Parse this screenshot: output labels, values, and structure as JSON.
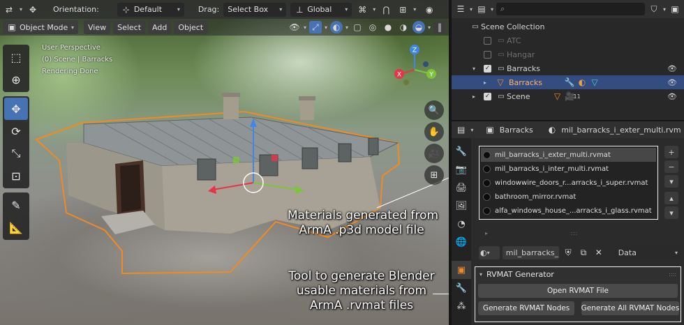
{
  "viewport": {
    "header": {
      "orientation_label": "Orientation:",
      "orientation_value": "Default",
      "drag_label": "Drag:",
      "drag_value": "Select Box",
      "transform_space": "Global"
    },
    "header2": {
      "mode": "Object Mode",
      "menus": [
        "View",
        "Select",
        "Add",
        "Object"
      ]
    },
    "info": [
      "User Perspective",
      "(0) Scene | Barracks",
      "Rendering Done"
    ],
    "gizmo_axes": {
      "z": "Z",
      "x": "X",
      "y": "Y"
    },
    "callouts": {
      "materials": [
        "Materials generated from",
        "ArmA .p3d model file"
      ],
      "tool": [
        "Tool to generate Blender",
        "usable materials from",
        "ArmA .rvmat files"
      ]
    },
    "colors": {
      "accent": "#4772b3",
      "selection_outline": "#f08a24",
      "axis_x": "#e8344a",
      "axis_y": "#7ec33a",
      "axis_z": "#3f86e6"
    }
  },
  "outliner": {
    "search_placeholder": "",
    "rows": [
      {
        "label": "Scene Collection",
        "checked": null,
        "dim": false
      },
      {
        "label": "ATC",
        "checked": false,
        "dim": true
      },
      {
        "label": "Hangar",
        "checked": false,
        "dim": true
      },
      {
        "label": "Barracks",
        "checked": true,
        "dim": false
      },
      {
        "label": "Barracks",
        "checked": null,
        "dim": false,
        "selected": true
      },
      {
        "label": "Scene",
        "checked": true,
        "dim": false
      }
    ],
    "scene_badge": "11"
  },
  "properties": {
    "header": {
      "object": "Barracks",
      "material": "mil_barracks_i_exter_multi.rvm"
    },
    "materials": [
      "mil_barracks_i_exter_multi.rvmat",
      "mil_barracks_i_inter_multi.rvmat",
      "windowwire_doors_r...arracks_i_super.rvmat",
      "bathroom_mirror.rvmat",
      "alfa_windows_house_...arracks_i_glass.rvmat"
    ],
    "slot": {
      "material_field": "mil_barracks_i...",
      "link": "Data"
    },
    "rvmat_panel": {
      "title": "RVMAT Generator",
      "open_button": "Open RVMAT File",
      "gen_button": "Generate RVMAT Nodes",
      "gen_all_button": "Generate All RVMAT Nodes"
    }
  }
}
